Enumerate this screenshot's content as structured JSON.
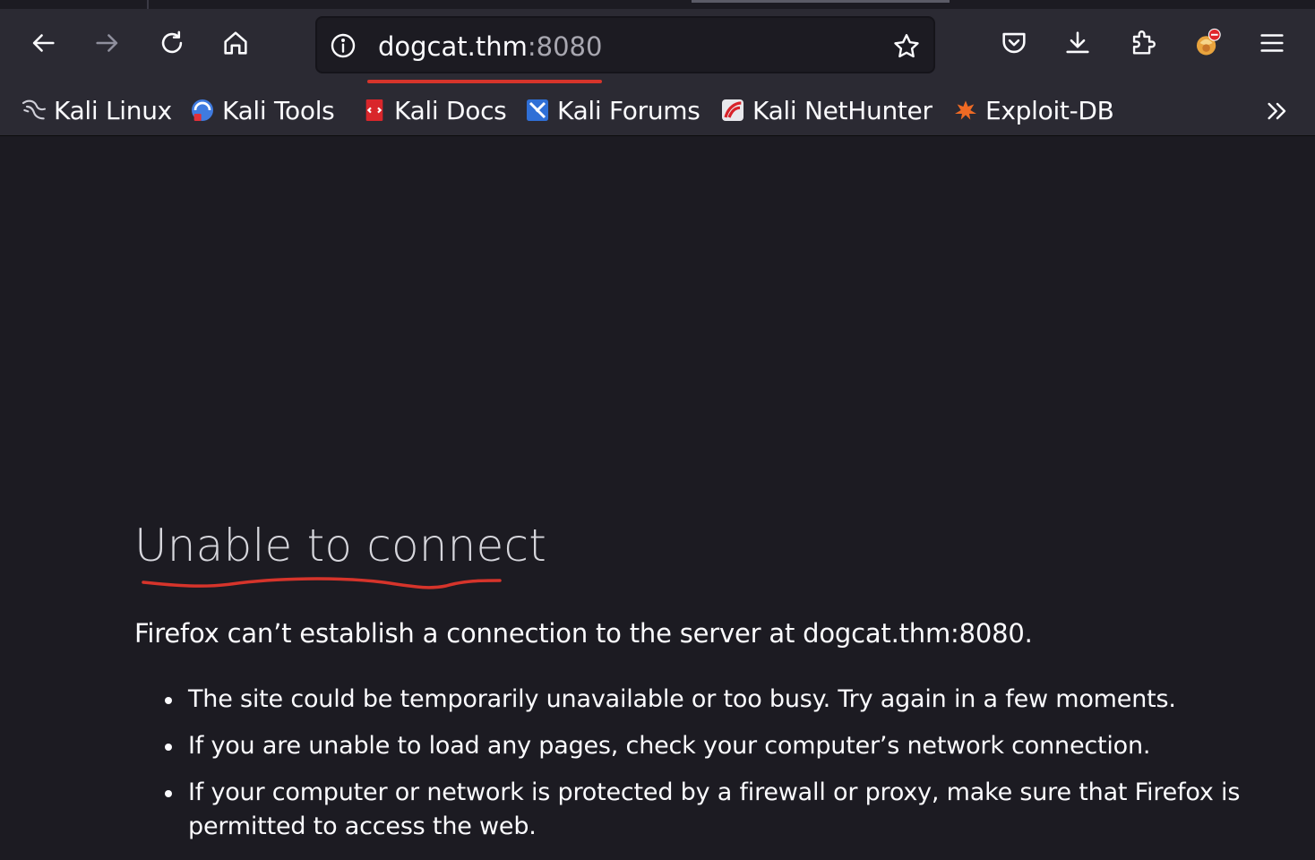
{
  "toolbar": {
    "back_icon": "back-arrow-icon",
    "forward_icon": "forward-arrow-icon",
    "reload_icon": "reload-icon",
    "home_icon": "home-icon",
    "pocket_icon": "pocket-icon",
    "downloads_icon": "download-icon",
    "extensions_icon": "extensions-icon",
    "profile_icon": "foxyproxy-icon",
    "menu_icon": "hamburger-menu-icon"
  },
  "urlbar": {
    "host": "dogcat.thm",
    "port": ":8080",
    "info_icon": "info-icon",
    "bookmark_icon": "star-icon"
  },
  "bookmarks": [
    {
      "label": "Kali Linux",
      "icon": "kali-dragon-icon"
    },
    {
      "label": "Kali Tools",
      "icon": "kali-tools-icon"
    },
    {
      "label": "Kali Docs",
      "icon": "kali-docs-icon"
    },
    {
      "label": "Kali Forums",
      "icon": "kali-forums-icon"
    },
    {
      "label": "Kali NetHunter",
      "icon": "kali-nethunter-icon"
    },
    {
      "label": "Exploit-DB",
      "icon": "exploit-db-icon"
    }
  ],
  "error": {
    "title": "Unable to connect",
    "description": "Firefox can’t establish a connection to the server at dogcat.thm:8080.",
    "suggestions": [
      "The site could be temporarily unavailable or too busy. Try again in a few moments.",
      "If you are unable to load any pages, check your computer’s network connection.",
      "If your computer or network is protected by a firewall or proxy, make sure that Firefox is permitted to access the web."
    ]
  },
  "colors": {
    "page_bg": "#1c1b22",
    "toolbar_bg": "#2b2a33",
    "annotation_red": "#d6342b"
  }
}
